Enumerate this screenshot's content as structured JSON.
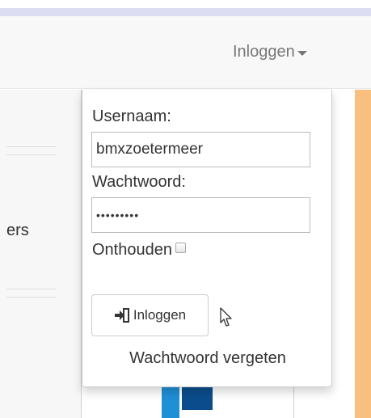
{
  "navbar": {
    "login_label": "Inloggen"
  },
  "left_panel": {
    "partial_text": "ers"
  },
  "login_dropdown": {
    "username_label": "Usernaam:",
    "username_value": "bmxzoetermeer",
    "password_label": "Wachtwoord:",
    "password_value": "•••••••••",
    "remember_label": "Onthouden",
    "remember_checked": false,
    "submit_label": "Inloggen",
    "submit_icon": "sign-in-icon",
    "forgot_label": "Wachtwoord vergeten"
  },
  "colors": {
    "top_bar": "#dcdcf2",
    "navbar_bg": "#f8f8f8",
    "accent_orange": "#f8bf7f",
    "logo_blue_light": "#1f8fd6",
    "logo_blue_dark": "#0b4d8c"
  }
}
